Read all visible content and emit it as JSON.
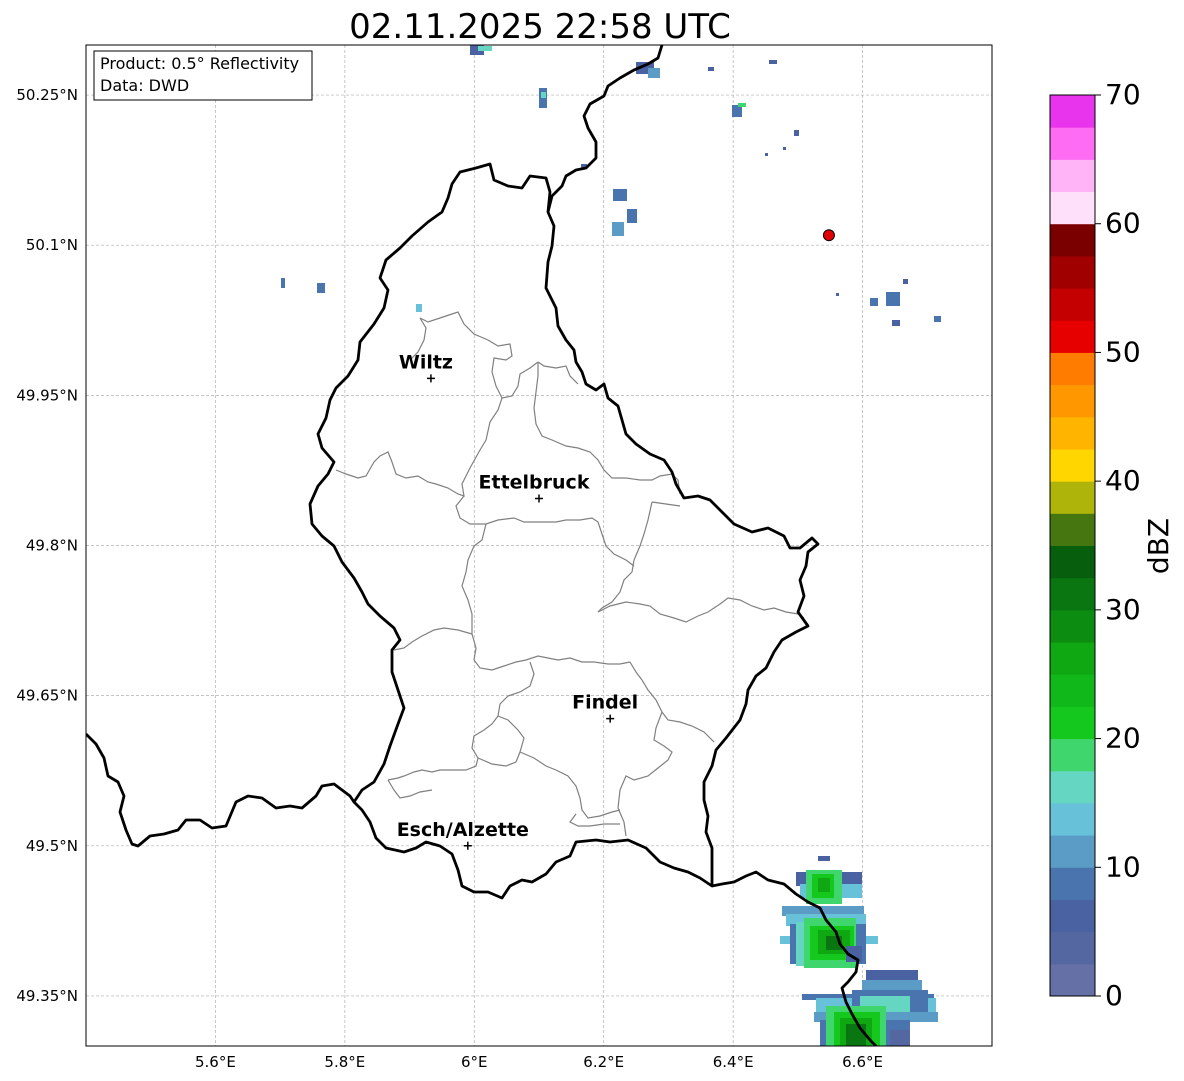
{
  "title": "02.11.2025 22:58 UTC",
  "info_box": {
    "product_line": "Product: 0.5° Reflectivity",
    "data_line": "Data: DWD"
  },
  "map": {
    "lon_range": [
      5.4,
      6.8
    ],
    "lat_range": [
      49.3,
      50.3
    ],
    "lon_ticks": [
      {
        "value": 5.6,
        "label": "5.6°E"
      },
      {
        "value": 5.8,
        "label": "5.8°E"
      },
      {
        "value": 6.0,
        "label": "6°E"
      },
      {
        "value": 6.2,
        "label": "6.2°E"
      },
      {
        "value": 6.4,
        "label": "6.4°E"
      },
      {
        "value": 6.6,
        "label": "6.6°E"
      }
    ],
    "lat_ticks": [
      {
        "value": 50.25,
        "label": "50.25°N"
      },
      {
        "value": 50.1,
        "label": "50.1°N"
      },
      {
        "value": 49.95,
        "label": "49.95°N"
      },
      {
        "value": 49.8,
        "label": "49.8°N"
      },
      {
        "value": 49.65,
        "label": "49.65°N"
      },
      {
        "value": 49.5,
        "label": "49.5°N"
      },
      {
        "value": 49.35,
        "label": "49.35°N"
      }
    ],
    "gridlines": true,
    "cities": [
      {
        "name": "Wiltz",
        "lon": 5.933,
        "lat": 49.967
      },
      {
        "name": "Ettelbruck",
        "lon": 6.1,
        "lat": 49.847
      },
      {
        "name": "Findel",
        "lon": 6.21,
        "lat": 49.627
      },
      {
        "name": "Esch/Alzette",
        "lon": 5.99,
        "lat": 49.5
      }
    ],
    "radar_site": {
      "lon": 6.548,
      "lat": 50.11,
      "color": "#e00000"
    }
  },
  "colorbar": {
    "label": "dBZ",
    "min": 0,
    "max": 70,
    "ticks": [
      0,
      10,
      20,
      30,
      40,
      50,
      60,
      70
    ],
    "colors": [
      "#6470a6",
      "#5567a0",
      "#4a62a2",
      "#4a74ae",
      "#5a9cc6",
      "#66c1d9",
      "#64d6c2",
      "#3fd66e",
      "#14c81e",
      "#10b81a",
      "#0fa812",
      "#0c8c10",
      "#097612",
      "#075e0c",
      "#467610",
      "#aeb40a",
      "#ffd600",
      "#ffb400",
      "#ff9800",
      "#ff7c00",
      "#e60000",
      "#c40000",
      "#a00000",
      "#7a0000",
      "#ffe0fa",
      "#ffb4f8",
      "#ff6cf4",
      "#e834ec"
    ]
  }
}
